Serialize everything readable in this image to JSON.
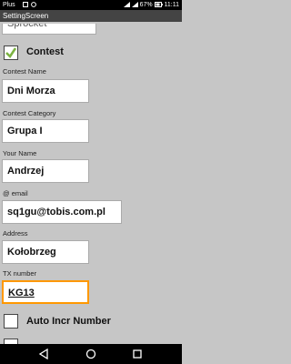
{
  "status_bar": {
    "carrier": "Plus",
    "battery": "67%",
    "time": "11:11"
  },
  "title": "SettingScreen",
  "top_field_partial": "Sprocket",
  "contest": {
    "label": "Contest",
    "checked": true
  },
  "fields": {
    "contest_name": {
      "label": "Contest Name",
      "value": "Dni Morza"
    },
    "contest_category": {
      "label": "Contest Category",
      "value": "Grupa I"
    },
    "your_name": {
      "label": "Your Name",
      "value": "Andrzej"
    },
    "email": {
      "label": "@ email",
      "value": "sq1gu@tobis.com.pl"
    },
    "address": {
      "label": "Address",
      "value": "Kołobrzeg"
    },
    "tx_number": {
      "label": "TX number",
      "value": "KG13"
    }
  },
  "auto_incr": {
    "label": "Auto Incr Number",
    "checked": false
  },
  "colors": {
    "accent": "#ff9800",
    "check_green": "#7cb342",
    "background": "#c6c6c6"
  }
}
